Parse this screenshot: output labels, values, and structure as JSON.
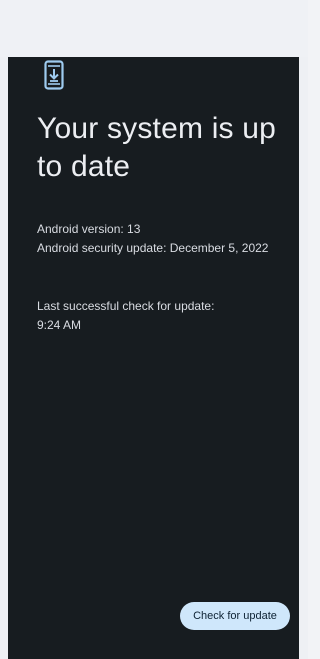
{
  "screen": {
    "icon": "system-update-icon",
    "title": "Your system is up to date",
    "android_version": "Android version: 13",
    "security_update": "Android security update: December 5, 2022",
    "last_check_label": "Last successful check for update:",
    "last_check_time": "9:24 AM",
    "check_button_label": "Check for update"
  },
  "colors": {
    "background": "#171c20",
    "text": "#e8eaee",
    "icon_accent": "#9ecbf0",
    "button_bg": "#cfe7fb",
    "button_text": "#0d2233"
  }
}
